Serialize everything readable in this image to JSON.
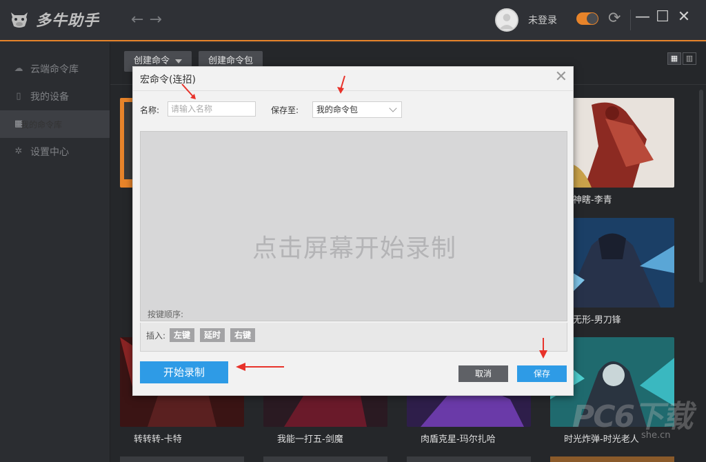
{
  "app": {
    "title": "多牛助手"
  },
  "header": {
    "back_glyph": "←",
    "forward_glyph": "→",
    "login_text": "未登录",
    "refresh_glyph": "⟳",
    "minimize_glyph": "—",
    "maximize_glyph": "☐",
    "close_glyph": "✕"
  },
  "sidebar": {
    "items": [
      {
        "label": "云端命令库",
        "icon": "cloud-icon",
        "active": false
      },
      {
        "label": "我的设备",
        "icon": "mouse-icon",
        "active": false
      },
      {
        "label": "我的命令库",
        "icon": "grid-icon",
        "active": true
      },
      {
        "label": "设置中心",
        "icon": "gear-icon",
        "active": false
      }
    ]
  },
  "toolbar": {
    "create_command": "创建命令",
    "create_package": "创建命令包"
  },
  "cards": [
    {
      "caption": "度神瞎-李青"
    },
    {
      "caption": "人无形-男刀锋"
    },
    {
      "caption": "转转转-卡特"
    },
    {
      "caption": "我能一打五-剑魔"
    },
    {
      "caption": "肉盾克星-玛尔扎哈"
    },
    {
      "caption": "时光炸弹-时光老人"
    }
  ],
  "modal": {
    "title": "宏命令(连招)",
    "close_glyph": "✕",
    "name_label": "名称:",
    "name_placeholder": "请输入名称",
    "save_to_label": "保存至:",
    "save_to_value": "我的命令包",
    "record_hint": "点击屏幕开始录制",
    "key_order_label": "按键顺序:",
    "insert_label": "插入:",
    "insert_buttons": [
      "左键",
      "延时",
      "右键"
    ],
    "start_record": "开始录制",
    "cancel": "取消",
    "save": "保存"
  },
  "colors": {
    "accent": "#e8842a",
    "primary_button": "#2e9be6",
    "annotation_arrow": "#e8322a"
  },
  "watermark": {
    "main": "PC6下载",
    "small": "she.cn"
  }
}
